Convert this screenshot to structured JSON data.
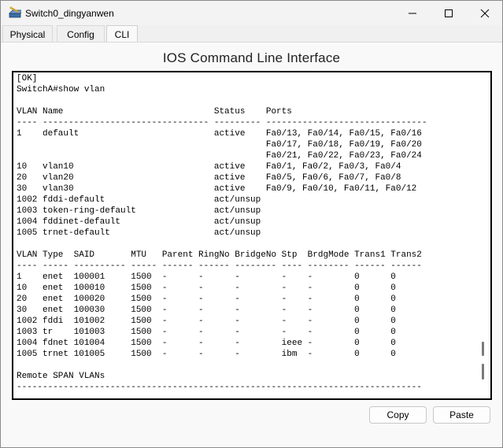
{
  "window": {
    "title": "Switch0_dingyanwen",
    "icon": "switch-app-icon"
  },
  "tabs": [
    {
      "label": "Physical",
      "active": false
    },
    {
      "label": "Config",
      "active": false
    },
    {
      "label": "CLI",
      "active": true
    }
  ],
  "cli": {
    "title": "IOS Command Line Interface",
    "lines": [
      "[OK]",
      "SwitchA#show vlan",
      "",
      "VLAN Name                             Status    Ports",
      "---- -------------------------------- --------- -------------------------------",
      "1    default                          active    Fa0/13, Fa0/14, Fa0/15, Fa0/16",
      "                                                Fa0/17, Fa0/18, Fa0/19, Fa0/20",
      "                                                Fa0/21, Fa0/22, Fa0/23, Fa0/24",
      "10   vlan10                           active    Fa0/1, Fa0/2, Fa0/3, Fa0/4",
      "20   vlan20                           active    Fa0/5, Fa0/6, Fa0/7, Fa0/8",
      "30   vlan30                           active    Fa0/9, Fa0/10, Fa0/11, Fa0/12",
      "1002 fddi-default                     act/unsup",
      "1003 token-ring-default               act/unsup",
      "1004 fddinet-default                  act/unsup",
      "1005 trnet-default                    act/unsup",
      "",
      "VLAN Type  SAID       MTU   Parent RingNo BridgeNo Stp  BrdgMode Trans1 Trans2",
      "---- ----- ---------- ----- ------ ------ -------- ---- -------- ------ ------",
      "1    enet  100001     1500  -      -      -        -    -        0      0",
      "10   enet  100010     1500  -      -      -        -    -        0      0",
      "20   enet  100020     1500  -      -      -        -    -        0      0",
      "30   enet  100030     1500  -      -      -        -    -        0      0",
      "1002 fddi  101002     1500  -      -      -        -    -        0      0",
      "1003 tr    101003     1500  -      -      -        -    -        0      0",
      "1004 fdnet 101004     1500  -      -      -        ieee -        0      0",
      "1005 trnet 101005     1500  -      -      -        ibm  -        0      0",
      "",
      "Remote SPAN VLANs",
      "------------------------------------------------------------------------------"
    ]
  },
  "buttons": {
    "copy": "Copy",
    "paste": "Paste"
  }
}
